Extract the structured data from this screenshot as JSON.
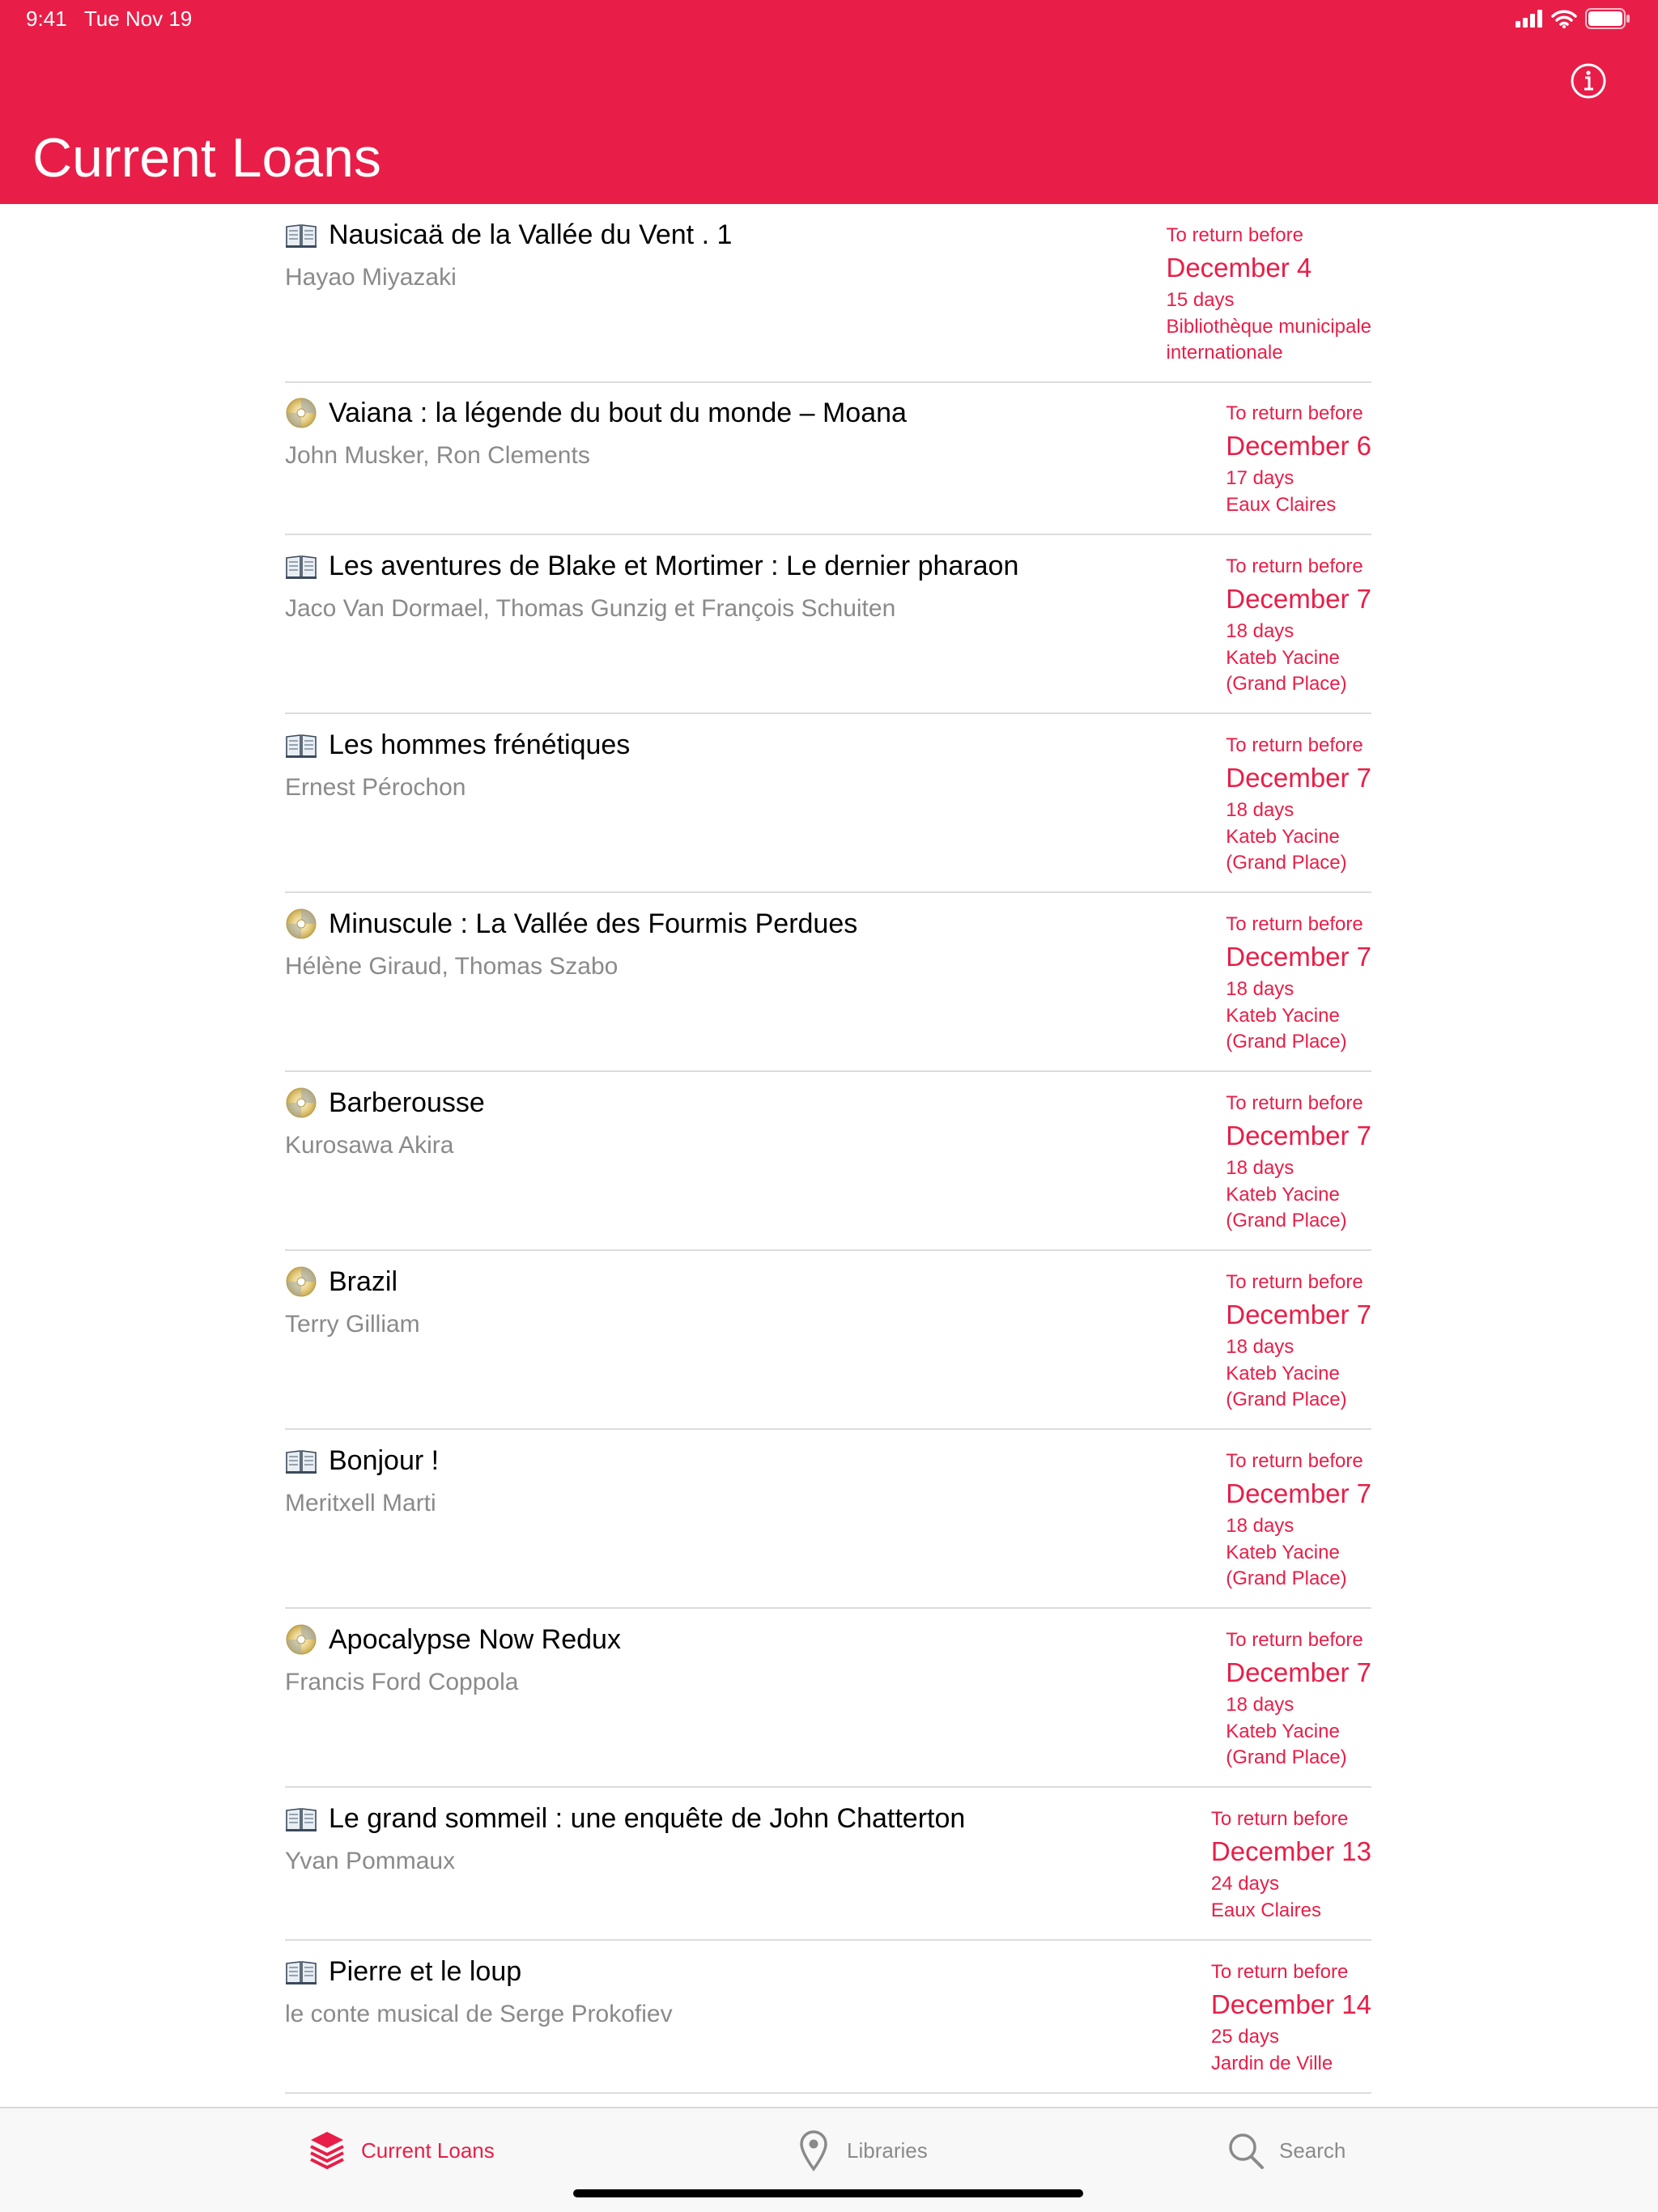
{
  "status_bar": {
    "time": "9:41",
    "date": "Tue Nov 19"
  },
  "header": {
    "title": "Current Loans",
    "info_icon": "info-circle-icon"
  },
  "colors": {
    "accent": "#E81E48",
    "secondary_text": "#8a8a8a",
    "separator": "#dcdcdc"
  },
  "loans": [
    {
      "type": "book",
      "title": "Nausicaä de la Vallée du Vent . 1",
      "author": "Hayao Miyazaki",
      "due_label": "To return before",
      "due_date": "December 4",
      "days": "15 days",
      "library": "Bibliothèque municipale\ninternationale"
    },
    {
      "type": "disc",
      "title": "Vaiana : la légende du bout du monde – Moana",
      "author": "John Musker, Ron Clements",
      "due_label": "To return before",
      "due_date": "December 6",
      "days": "17 days",
      "library": "Eaux Claires"
    },
    {
      "type": "book",
      "title": "Les aventures de Blake et Mortimer : Le dernier pharaon",
      "author": "Jaco Van Dormael, Thomas Gunzig et François Schuiten",
      "due_label": "To return before",
      "due_date": "December 7",
      "days": "18 days",
      "library": "Kateb Yacine\n(Grand Place)"
    },
    {
      "type": "book",
      "title": "Les hommes frénétiques",
      "author": "Ernest Pérochon",
      "due_label": "To return before",
      "due_date": "December 7",
      "days": "18 days",
      "library": "Kateb Yacine\n(Grand Place)"
    },
    {
      "type": "disc",
      "title": "Minuscule : La Vallée des Fourmis Perdues",
      "author": "Hélène Giraud, Thomas Szabo",
      "due_label": "To return before",
      "due_date": "December 7",
      "days": "18 days",
      "library": "Kateb Yacine\n(Grand Place)"
    },
    {
      "type": "disc",
      "title": "Barberousse",
      "author": "Kurosawa Akira",
      "due_label": "To return before",
      "due_date": "December 7",
      "days": "18 days",
      "library": "Kateb Yacine\n(Grand Place)"
    },
    {
      "type": "disc",
      "title": "Brazil",
      "author": "Terry Gilliam",
      "due_label": "To return before",
      "due_date": "December 7",
      "days": "18 days",
      "library": "Kateb Yacine\n(Grand Place)"
    },
    {
      "type": "book",
      "title": "Bonjour !",
      "author": "Meritxell Marti",
      "due_label": "To return before",
      "due_date": "December 7",
      "days": "18 days",
      "library": "Kateb Yacine\n(Grand Place)"
    },
    {
      "type": "disc",
      "title": "Apocalypse Now Redux",
      "author": "Francis Ford Coppola",
      "due_label": "To return before",
      "due_date": "December 7",
      "days": "18 days",
      "library": "Kateb Yacine\n(Grand Place)"
    },
    {
      "type": "book",
      "title": "Le grand sommeil : une enquête de John Chatterton",
      "author": "Yvan Pommaux",
      "due_label": "To return before",
      "due_date": "December 13",
      "days": "24 days",
      "library": "Eaux Claires"
    },
    {
      "type": "book",
      "title": "Pierre et le loup",
      "author": "le conte musical de Serge Prokofiev",
      "due_label": "To return before",
      "due_date": "December 14",
      "days": "25 days",
      "library": "Jardin de Ville"
    }
  ],
  "tabbar": {
    "tabs": [
      {
        "label": "Current Loans",
        "icon": "stacked-books-icon",
        "active": true
      },
      {
        "label": "Libraries",
        "icon": "map-pin-icon",
        "active": false
      },
      {
        "label": "Search",
        "icon": "magnifier-icon",
        "active": false
      }
    ]
  }
}
